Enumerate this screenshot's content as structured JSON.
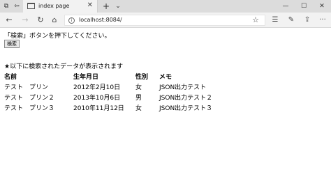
{
  "browser": {
    "tab_title": "index page",
    "new_tab_icon": "plus-icon",
    "tab_list_icon": "chevron-down-icon",
    "url": "localhost:8084/"
  },
  "page": {
    "instruction": "「検索」ボタンを押下してください。",
    "search_label": "検索",
    "result_message": "★以下に検索されたデータが表示されます",
    "headers": [
      "名前",
      "生年月日",
      "性別",
      "メモ"
    ],
    "rows": [
      [
        "テスト　プリン",
        "2012年2月10日",
        "女",
        "JSON出力テスト"
      ],
      [
        "テスト　プリン２",
        "2013年10月6日",
        "男",
        "JSON出力テスト２"
      ],
      [
        "テスト　プリン３",
        "2010年11月12日",
        "女",
        "JSON出力テスト３"
      ]
    ]
  }
}
